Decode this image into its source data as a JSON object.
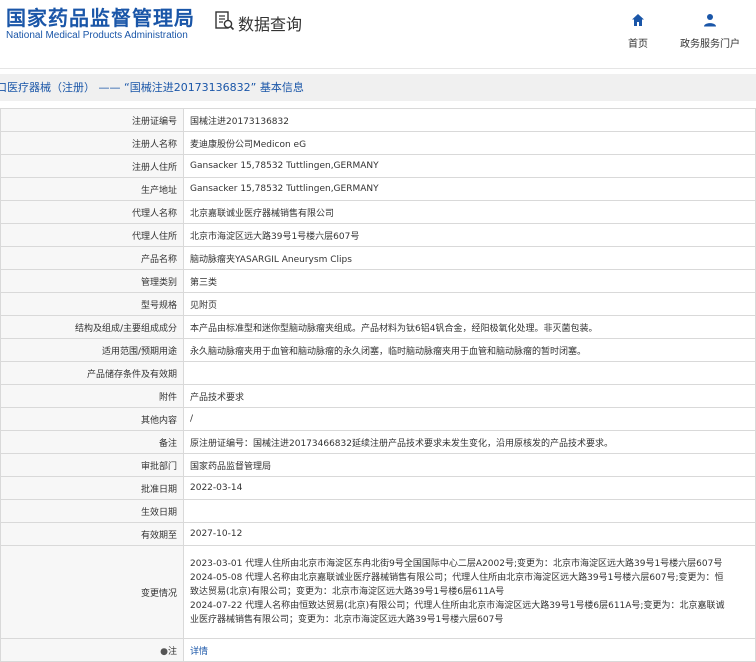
{
  "header": {
    "logo_cn": "国家药品监督管理局",
    "logo_en": "National Medical Products Administration",
    "section_title": "数据查询",
    "nav": [
      {
        "label": "首页"
      },
      {
        "label": "政务服务门户"
      }
    ]
  },
  "title": "口医疗器械（注册） —— “国械注进20173136832” 基本信息",
  "fields": [
    {
      "label": "注册证编号",
      "value": "国械注进20173136832"
    },
    {
      "label": "注册人名称",
      "value": "麦迪康股份公司Medicon eG"
    },
    {
      "label": "注册人住所",
      "value": "Gansacker 15,78532 Tuttlingen,GERMANY"
    },
    {
      "label": "生产地址",
      "value": "Gansacker 15,78532 Tuttlingen,GERMANY"
    },
    {
      "label": "代理人名称",
      "value": "北京嘉联诚业医疗器械销售有限公司"
    },
    {
      "label": "代理人住所",
      "value": "北京市海淀区远大路39号1号楼六层607号"
    },
    {
      "label": "产品名称",
      "value": "脑动脉瘤夹YASARGIL Aneurysm Clips"
    },
    {
      "label": "管理类别",
      "value": "第三类"
    },
    {
      "label": "型号规格",
      "value": "见附页"
    },
    {
      "label": "结构及组成/主要组成成分",
      "value": "本产品由标准型和迷你型脑动脉瘤夹组成。产品材料为钛6铝4钒合金，经阳极氧化处理。非灭菌包装。"
    },
    {
      "label": "适用范围/预期用途",
      "value": "永久脑动脉瘤夹用于血管和脑动脉瘤的永久闭塞，临时脑动脉瘤夹用于血管和脑动脉瘤的暂时闭塞。"
    },
    {
      "label": "产品储存条件及有效期",
      "value": ""
    },
    {
      "label": "附件",
      "value": "产品技术要求"
    },
    {
      "label": "其他内容",
      "value": "/"
    },
    {
      "label": "备注",
      "value": "原注册证编号：国械注进20173466832延续注册产品技术要求未发生变化，沿用原核发的产品技术要求。"
    },
    {
      "label": "审批部门",
      "value": "国家药品监督管理局"
    },
    {
      "label": "批准日期",
      "value": "2022-03-14"
    },
    {
      "label": "生效日期",
      "value": ""
    },
    {
      "label": "有效期至",
      "value": "2027-10-12"
    }
  ],
  "changes": {
    "label": "变更情况",
    "lines": [
      "2023-03-01 代理人住所由北京市海淀区东冉北街9号全国国际中心二层A2002号;变更为：北京市海淀区远大路39号1号楼六层607号",
      "2024-05-08 代理人名称由北京嘉联诚业医疗器械销售有限公司；代理人住所由北京市海淀区远大路39号1号楼六层607号;变更为：恒",
      "致达贸易(北京)有限公司；变更为：北京市海淀区远大路39号1号楼6层611A号",
      "2024-07-22 代理人名称由恒致达贸易(北京)有限公司；代理人住所由北京市海淀区远大路39号1号楼6层611A号;变更为：北京嘉联诚",
      "业医疗器械销售有限公司；变更为：北京市海淀区远大路39号1号楼六层607号"
    ]
  },
  "note": {
    "label": "注",
    "link": "详情"
  }
}
